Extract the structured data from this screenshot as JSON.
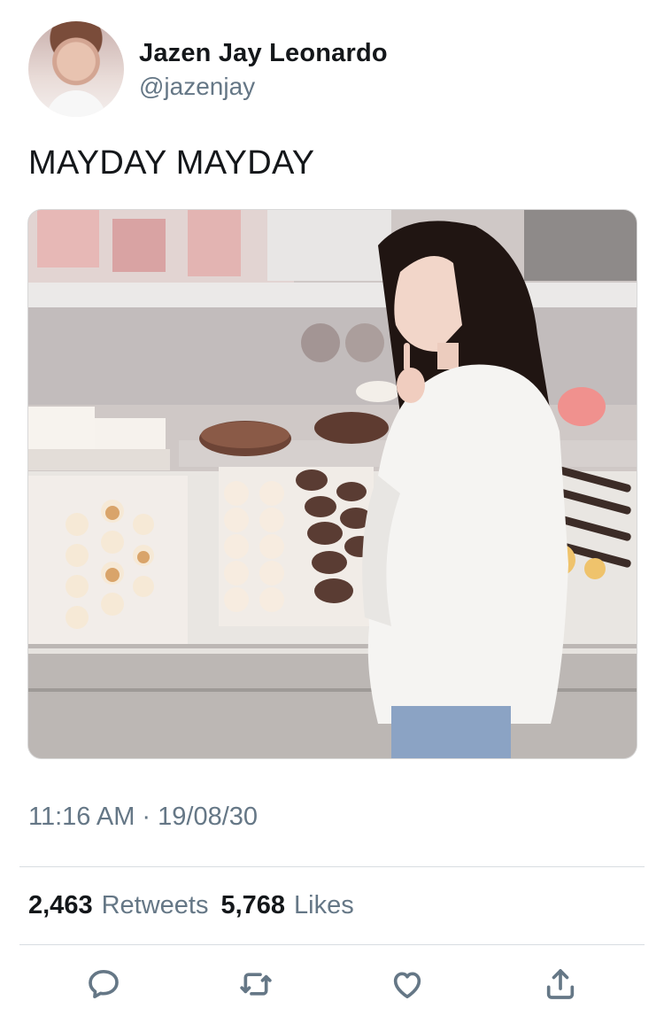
{
  "user": {
    "display_name": "Jazen Jay Leonardo",
    "handle": "@jazenjay"
  },
  "tweet": {
    "text": "MAYDAY MAYDAY",
    "timestamp": "11:16 AM · 19/08/30"
  },
  "media": {
    "emojis": [
      "🥐",
      "🥯",
      "🍞",
      "🥖",
      "🥨",
      "🥞",
      "🧁",
      "🍰",
      "🍩",
      "🍪",
      "🤔"
    ]
  },
  "stats": {
    "retweets_count": "2,463",
    "retweets_label": "Retweets",
    "likes_count": "5,768",
    "likes_label": "Likes"
  },
  "actions": {
    "reply_icon": "reply-icon",
    "retweet_icon": "retweet-icon",
    "like_icon": "heart-icon",
    "share_icon": "share-icon"
  },
  "colors": {
    "text": "#14171a",
    "secondary": "#657786",
    "divider": "#d8dde1"
  }
}
